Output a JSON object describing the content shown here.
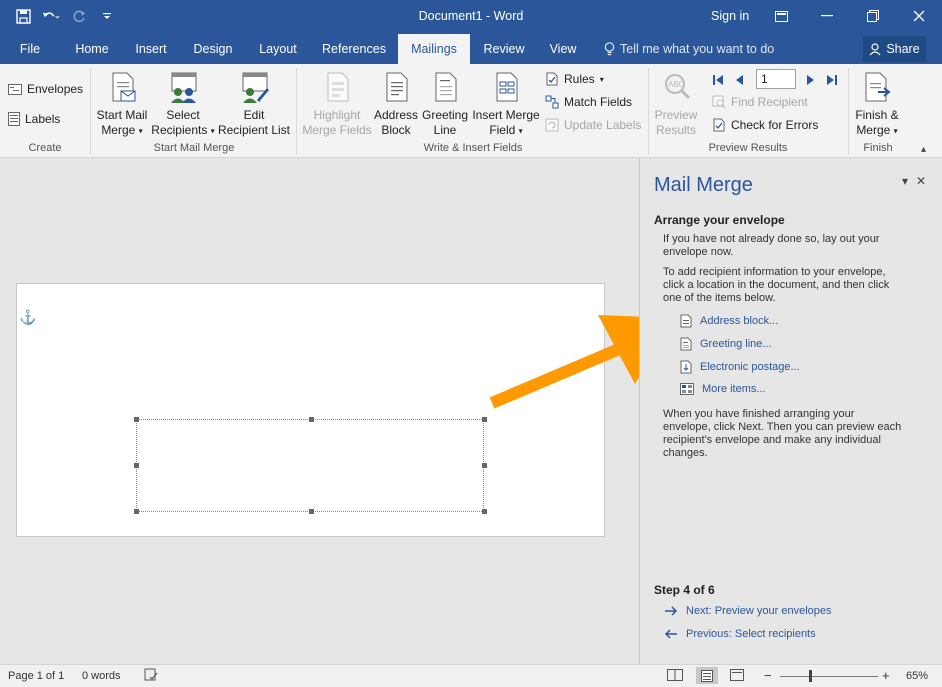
{
  "window": {
    "title": "Document1 - Word",
    "sign_in": "Sign in"
  },
  "tabs": [
    {
      "label": "File"
    },
    {
      "label": "Home"
    },
    {
      "label": "Insert"
    },
    {
      "label": "Design"
    },
    {
      "label": "Layout"
    },
    {
      "label": "References"
    },
    {
      "label": "Mailings",
      "active": true
    },
    {
      "label": "Review"
    },
    {
      "label": "View"
    }
  ],
  "tell_me": "Tell me what you want to do",
  "share_label": "Share",
  "ribbon": {
    "create": {
      "label": "Create",
      "envelopes": "Envelopes",
      "labels": "Labels"
    },
    "start_mail_merge": {
      "label": "Start Mail Merge",
      "start_line1": "Start Mail",
      "start_line2": "Merge",
      "select_line1": "Select",
      "select_line2": "Recipients",
      "edit_line1": "Edit",
      "edit_line2": "Recipient List"
    },
    "write_insert": {
      "label": "Write & Insert Fields",
      "highlight_line1": "Highlight",
      "highlight_line2": "Merge Fields",
      "address_line1": "Address",
      "address_line2": "Block",
      "greeting_line1": "Greeting",
      "greeting_line2": "Line",
      "insert_line1": "Insert Merge",
      "insert_line2": "Field",
      "rules": "Rules",
      "match_fields": "Match Fields",
      "update_labels": "Update Labels"
    },
    "preview": {
      "label": "Preview Results",
      "preview_line1": "Preview",
      "preview_line2": "Results",
      "record_number": "1",
      "find_recipient": "Find Recipient",
      "check_errors": "Check for Errors"
    },
    "finish": {
      "label": "Finish",
      "finish_line1": "Finish &",
      "finish_line2": "Merge"
    }
  },
  "pane": {
    "title": "Mail Merge",
    "heading": "Arrange your envelope",
    "intro_line1": "If you have not already done so, lay out your",
    "intro_line2": "envelope now.",
    "instr_line1": "To add recipient information to your envelope,",
    "instr_line2": "click a location in the document, and then click",
    "instr_line3": "one of the items below.",
    "links": {
      "address_block": "Address block...",
      "greeting_line": "Greeting line...",
      "electronic_postage": "Electronic postage...",
      "more_items": "More items..."
    },
    "finish_line1": "When you have finished arranging your",
    "finish_line2": "envelope, click Next. Then you can preview each",
    "finish_line3": "recipient's envelope and make any individual",
    "finish_line4": "changes.",
    "step": "Step 4 of 6",
    "next": "Next: Preview your envelopes",
    "previous": "Previous: Select recipients"
  },
  "status": {
    "page": "Page 1 of 1",
    "words": "0 words",
    "zoom": "65%"
  },
  "colors": {
    "accent": "#2b579a",
    "annotation_arrow": "#ff9900"
  }
}
